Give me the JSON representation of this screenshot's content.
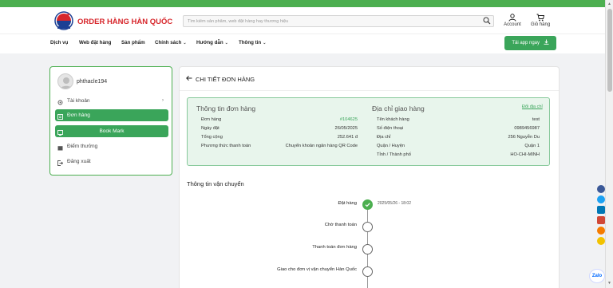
{
  "header": {
    "brand": "ORDER HÀNG HÀN QUỐC",
    "search_placeholder": "Tìm kiếm sản phẩm, web đặt hàng hay thương hiệu",
    "account_label": "Account",
    "cart_label": "Giỏ hàng"
  },
  "nav": {
    "items": [
      "Dịch vụ",
      "Web đặt hàng",
      "Sản phẩm",
      "Chính sách",
      "Hướng dẫn",
      "Thông tin"
    ],
    "app_button": "Tải app ngay"
  },
  "sidebar": {
    "username": "phthacle194",
    "items": [
      "Tài khoản",
      "Đơn hàng",
      "Book Mark",
      "Điểm thưởng",
      "Đăng xuất"
    ]
  },
  "main": {
    "title": "CHI TIẾT ĐƠN HÀNG",
    "order_info": {
      "heading": "Thông tin đơn hàng",
      "rows": [
        {
          "label": "Đơn hàng",
          "value": "#104625"
        },
        {
          "label": "Ngày đặt",
          "value": "26/05/2025"
        },
        {
          "label": "Tổng cộng",
          "value": "252.641 đ"
        },
        {
          "label": "Phương thức thanh toán",
          "value": "Chuyển khoản ngân hàng QR Code"
        }
      ]
    },
    "address": {
      "heading": "Địa chỉ giao hàng",
      "change_link": "Đổi địa chỉ",
      "rows": [
        {
          "label": "Tên khách hàng",
          "value": "test"
        },
        {
          "label": "Số điện thoại",
          "value": "0989456987"
        },
        {
          "label": "Địa chỉ",
          "value": "256 Nguyễn Du"
        },
        {
          "label": "Quận / Huyện",
          "value": "Quận 1"
        },
        {
          "label": "Tỉnh / Thành phố",
          "value": "HO-CHI-MINH"
        }
      ]
    },
    "shipping": {
      "title": "Thông tin vận chuyển",
      "steps": [
        {
          "label": "Đặt hàng",
          "time": "2025/05/26 - 18:02",
          "done": true
        },
        {
          "label": "Chờ thanh toán",
          "time": "",
          "done": false
        },
        {
          "label": "Thanh toán đơn hàng",
          "time": "",
          "done": false
        },
        {
          "label": "Giao cho đơn vị vận chuyển Hàn Quốc",
          "time": "",
          "done": false
        }
      ]
    }
  },
  "floating": {
    "zalo_label": "Zalo"
  },
  "colors": {
    "accent": "#3aa55a",
    "brand_red": "#d7262b",
    "info_bg": "#e8f5ec"
  }
}
